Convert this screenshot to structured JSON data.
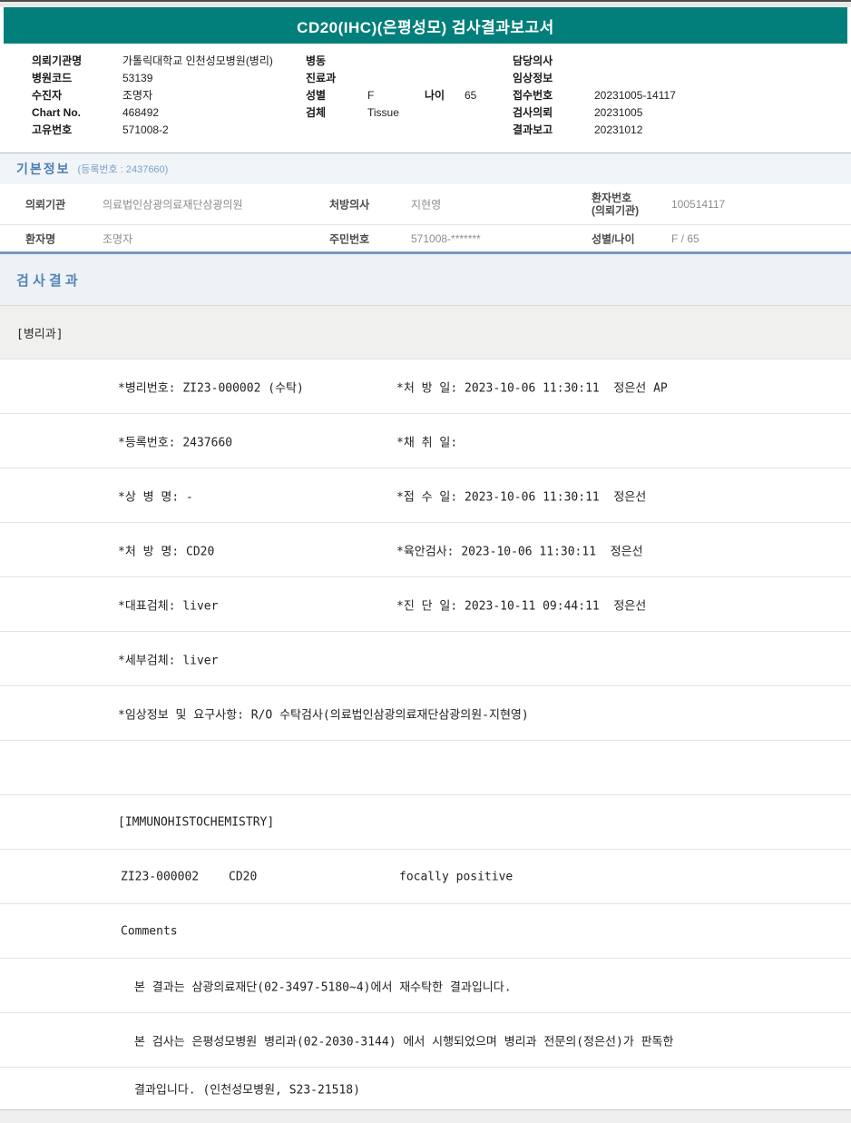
{
  "title": "CD20(IHC)(은평성모) 검사결과보고서",
  "colors": {
    "title_bar_teal": "#027f7a",
    "section_text_blue": "#4d7eb2",
    "divider_blue": "#7697bd"
  },
  "header": {
    "left": [
      {
        "label": "의뢰기관명",
        "value": "가톨릭대학교 인천성모병원(병리)"
      },
      {
        "label": "병원코드",
        "value": "53139"
      },
      {
        "label": "수진자",
        "value": "조명자"
      },
      {
        "label": "Chart No.",
        "value": "468492"
      },
      {
        "label": "고유번호",
        "value": "571008-2"
      }
    ],
    "middle": [
      {
        "label": "병동",
        "value": ""
      },
      {
        "label": "진료과",
        "value": ""
      },
      {
        "label": "성별",
        "value": "F",
        "label2": "나이",
        "value2": "65"
      },
      {
        "label": "검체",
        "value": "Tissue"
      }
    ],
    "right": [
      {
        "label": "담당의사",
        "value": ""
      },
      {
        "label": "임상정보",
        "value": ""
      },
      {
        "label": "접수번호",
        "value": "20231005-14117"
      },
      {
        "label": "검사의뢰",
        "value": "20231005"
      },
      {
        "label": "결과보고",
        "value": "20231012"
      }
    ]
  },
  "basic_info": {
    "section_title": "기본정보",
    "section_sub": "(등록번호 : 2437660)",
    "row1": {
      "c1l": "의뢰기관",
      "c1v": "의료법인삼광의료재단삼광의원",
      "c2l": "처방의사",
      "c2v": "지현영",
      "c3l_line1": "환자번호",
      "c3l_line2": "(의뢰기관)",
      "c3v": "100514117"
    },
    "row2": {
      "c1l": "환자명",
      "c1v": "조명자",
      "c2l": "주민번호",
      "c2v": "571008-*******",
      "c3l": "성별/나이",
      "c3v": "F / 65"
    }
  },
  "results": {
    "section_title": "검 사 결 과",
    "department": "[병리과]",
    "rows": [
      {
        "left": "*병리번호: ZI23-000002 (수탁)",
        "right": "*처 방 일: 2023-10-06 11:30:11  정은선 AP"
      },
      {
        "left": "*등록번호: 2437660",
        "right": "*채 취 일:"
      },
      {
        "left": "*상 병 명: -",
        "right": "*접 수 일: 2023-10-06 11:30:11  정은선"
      },
      {
        "left": "*처 방 명: CD20",
        "right": "*육안검사: 2023-10-06 11:30:11  정은선"
      },
      {
        "left": "*대표검체: liver",
        "right": "*진 단 일: 2023-10-11 09:44:11  정은선"
      },
      {
        "left": "*세부검체: liver",
        "right": ""
      },
      {
        "left": "*임상정보 및 요구사항: R/O 수탁검사(의료법인삼광의료재단삼광의원-지현영)",
        "right": ""
      },
      {
        "left": "",
        "right": ""
      },
      {
        "left": "[IMMUNOHISTOCHEMISTRY]",
        "right": ""
      }
    ],
    "ihc_row": {
      "c1": "ZI23-000002",
      "c2": "CD20",
      "c3": "focally positive"
    },
    "comments_label": "Comments",
    "comment_lines": [
      "본 결과는 삼광의료재단(02-3497-5180~4)에서 재수탁한 결과입니다.",
      "본 검사는 은평성모병원 병리과(02-2030-3144) 에서 시행되었으며 병리과 전문의(정은선)가 판독한",
      "결과입니다. (인천성모병원, S23-21518)"
    ]
  }
}
